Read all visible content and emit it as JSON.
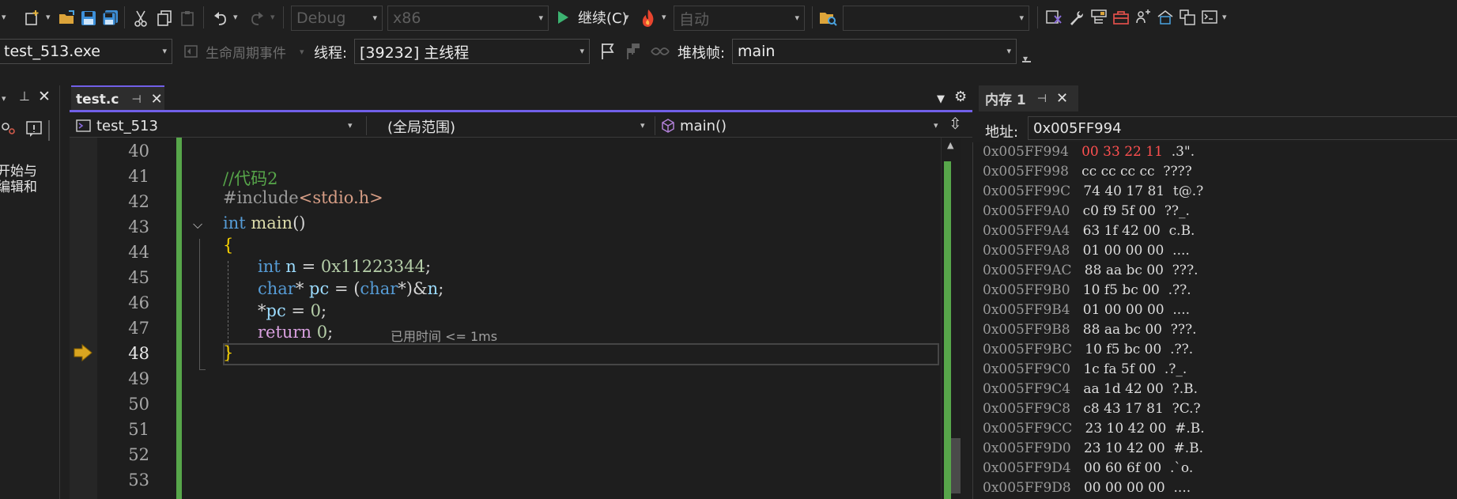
{
  "toolbar": {
    "config_combo": "Debug",
    "platform_combo": "x86",
    "continue_label": "继续(C)",
    "auto_combo": "自动",
    "search_combo": ""
  },
  "debug_toolbar": {
    "process_combo": "test_513.exe",
    "lifecycle_label": "生命周期事件",
    "thread_label": "线程:",
    "thread_combo": "[39232] 主线程",
    "stack_label": "堆栈帧:",
    "stack_combo": "main"
  },
  "left_pane": {
    "text_line1": "开始与",
    "text_line2": "编辑和"
  },
  "editor": {
    "tab_title": "test.c",
    "nav_project": "test_513",
    "nav_scope": "(全局范围)",
    "nav_function": "main()",
    "line_numbers": [
      "40",
      "41",
      "42",
      "43",
      "44",
      "45",
      "46",
      "47",
      "48",
      "49",
      "50",
      "51",
      "52",
      "53"
    ],
    "code": {
      "comment": "//代码2",
      "include_directive": "#include",
      "include_file": "<stdio.h>",
      "kw_int": "int",
      "fn_main": "main",
      "parens": "()",
      "open_brace": "{",
      "close_brace": "}",
      "l45_kw": "int",
      "l45_var": "n",
      "l45_eq": " = ",
      "l45_num": "0x11223344",
      "l45_end": ";",
      "l46_kw": "char",
      "l46_star": "* ",
      "l46_var": "pc",
      "l46_eq": " = (",
      "l46_kw2": "char",
      "l46_cast": "*)&",
      "l46_var2": "n",
      "l46_end": ";",
      "l47_star": "*",
      "l47_var": "pc",
      "l47_eq": " = ",
      "l47_num": "0",
      "l47_end": ";",
      "l48_kw": "return",
      "l48_num": "0",
      "l48_end": ";",
      "perf_tip": "已用时间 <= 1ms"
    }
  },
  "memory": {
    "tab_title": "内存 1",
    "address_label": "地址:",
    "address_value": "0x005FF994",
    "rows": [
      {
        "addr": "0x005FF994",
        "bytes": [
          "00",
          "33",
          "22",
          "11"
        ],
        "chars": ".3\"."
      },
      {
        "addr": "0x005FF998",
        "bytes": [
          "cc",
          "cc",
          "cc",
          "cc"
        ],
        "chars": "????"
      },
      {
        "addr": "0x005FF99C",
        "bytes": [
          "74",
          "40",
          "17",
          "81"
        ],
        "chars": "t@.?"
      },
      {
        "addr": "0x005FF9A0",
        "bytes": [
          "c0",
          "f9",
          "5f",
          "00"
        ],
        "chars": "??_."
      },
      {
        "addr": "0x005FF9A4",
        "bytes": [
          "63",
          "1f",
          "42",
          "00"
        ],
        "chars": "c.B."
      },
      {
        "addr": "0x005FF9A8",
        "bytes": [
          "01",
          "00",
          "00",
          "00"
        ],
        "chars": "...."
      },
      {
        "addr": "0x005FF9AC",
        "bytes": [
          "88",
          "aa",
          "bc",
          "00"
        ],
        "chars": "???."
      },
      {
        "addr": "0x005FF9B0",
        "bytes": [
          "10",
          "f5",
          "bc",
          "00"
        ],
        "chars": ".??."
      },
      {
        "addr": "0x005FF9B4",
        "bytes": [
          "01",
          "00",
          "00",
          "00"
        ],
        "chars": "...."
      },
      {
        "addr": "0x005FF9B8",
        "bytes": [
          "88",
          "aa",
          "bc",
          "00"
        ],
        "chars": "???."
      },
      {
        "addr": "0x005FF9BC",
        "bytes": [
          "10",
          "f5",
          "bc",
          "00"
        ],
        "chars": ".??."
      },
      {
        "addr": "0x005FF9C0",
        "bytes": [
          "1c",
          "fa",
          "5f",
          "00"
        ],
        "chars": ".?_."
      },
      {
        "addr": "0x005FF9C4",
        "bytes": [
          "aa",
          "1d",
          "42",
          "00"
        ],
        "chars": "?.B."
      },
      {
        "addr": "0x005FF9C8",
        "bytes": [
          "c8",
          "43",
          "17",
          "81"
        ],
        "chars": "?C.?"
      },
      {
        "addr": "0x005FF9CC",
        "bytes": [
          "23",
          "10",
          "42",
          "00"
        ],
        "chars": "#.B."
      },
      {
        "addr": "0x005FF9D0",
        "bytes": [
          "23",
          "10",
          "42",
          "00"
        ],
        "chars": "#.B."
      },
      {
        "addr": "0x005FF9D4",
        "bytes": [
          "00",
          "60",
          "6f",
          "00"
        ],
        "chars": ".`o."
      },
      {
        "addr": "0x005FF9D8",
        "bytes": [
          "00",
          "00",
          "00",
          "00"
        ],
        "chars": "...."
      }
    ]
  },
  "colors": {
    "accent": "#7160e8",
    "change_bar": "#57a64a",
    "current_statement_arrow": "#d9a520",
    "keyword": "#569cd6",
    "comment": "#57a64a",
    "changed_byte": "#ff5050"
  }
}
